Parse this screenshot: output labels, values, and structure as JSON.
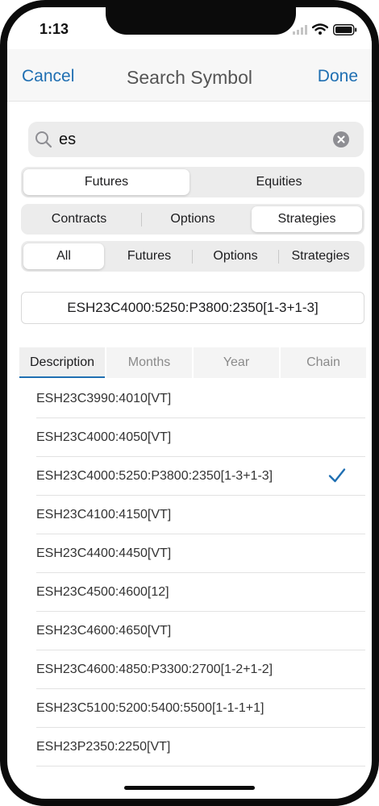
{
  "status": {
    "time": "1:13"
  },
  "nav": {
    "cancel": "Cancel",
    "title": "Search Symbol",
    "done": "Done"
  },
  "search": {
    "value": "es"
  },
  "seg1": {
    "items": [
      "Futures",
      "Equities"
    ],
    "selected": "Futures"
  },
  "seg2": {
    "items": [
      "Contracts",
      "Options",
      "Strategies"
    ],
    "selected": "Strategies"
  },
  "seg3": {
    "items": [
      "All",
      "Futures",
      "Options",
      "Strategies"
    ],
    "selected": "All"
  },
  "selected_symbol": "ESH23C4000:5250:P3800:2350[1-3+1-3]",
  "tabs": {
    "items": [
      "Description",
      "Months",
      "Year",
      "Chain"
    ],
    "selected": "Description"
  },
  "results": [
    {
      "label": "ESH23C3990:4010[VT]"
    },
    {
      "label": "ESH23C4000:4050[VT]"
    },
    {
      "label": "ESH23C4000:5250:P3800:2350[1-3+1-3]",
      "checked": true
    },
    {
      "label": "ESH23C4100:4150[VT]"
    },
    {
      "label": "ESH23C4400:4450[VT]"
    },
    {
      "label": "ESH23C4500:4600[12]"
    },
    {
      "label": "ESH23C4600:4650[VT]"
    },
    {
      "label": "ESH23C4600:4850:P3300:2700[1-2+1-2]"
    },
    {
      "label": "ESH23C5100:5200:5400:5500[1-1-1+1]"
    },
    {
      "label": "ESH23P2350:2250[VT]"
    }
  ],
  "colors": {
    "accent": "#1f6fb2",
    "segment_bg": "#ececec"
  },
  "icons": {
    "search": "magnifier-icon",
    "clear": "clear-x-circle-icon",
    "check": "checkmark-icon"
  }
}
